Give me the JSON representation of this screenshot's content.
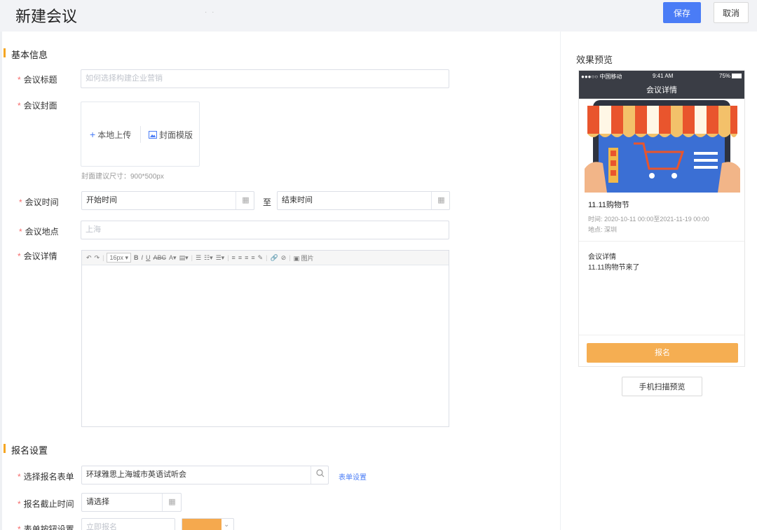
{
  "header": {
    "title": "新建会议",
    "dots": "· ·",
    "save_label": "保存",
    "cancel_label": "取消"
  },
  "basic": {
    "section_title": "基本信息",
    "title_label": "会议标题",
    "title_placeholder": "如何选择构建企业营销",
    "cover_label": "会议封面",
    "cover_upload": "本地上传",
    "cover_template": "封面模版",
    "cover_hint": "封面建议尺寸：900*500px",
    "time_label": "会议时间",
    "start_placeholder": "开始时间",
    "to": "至",
    "end_placeholder": "结束时间",
    "location_label": "会议地点",
    "location_placeholder": "上海",
    "detail_label": "会议详情",
    "editor_font_size": "16px",
    "editor_image": "图片"
  },
  "signup": {
    "section_title": "报名设置",
    "form_label": "选择报名表单",
    "form_value": "环球雅思上海城市英语试听会",
    "form_link": "表单设置",
    "deadline_label": "报名截止时间",
    "deadline_placeholder": "请选择",
    "button_label": "表单按钮设置",
    "button_placeholder": "立即报名",
    "button_color": "#f5a94e"
  },
  "preview": {
    "title": "效果预览",
    "status_carrier": "●●●○○ 中国移动",
    "status_time": "9:41 AM",
    "status_battery": "75%",
    "nav_title": "会议详情",
    "event_title": "11.11购物节",
    "event_time": "时间:  2020-10-11 00:00至2021-11-19 00:00",
    "event_location": "地点:  深圳",
    "detail_heading": "会议详情",
    "detail_text": "11.11购物节来了",
    "signup_button": "报名",
    "scan_button": "手机扫描预览"
  },
  "colors": {
    "accent": "#4a7cf6",
    "orange": "#f5a623",
    "required": "#f56c6c"
  }
}
